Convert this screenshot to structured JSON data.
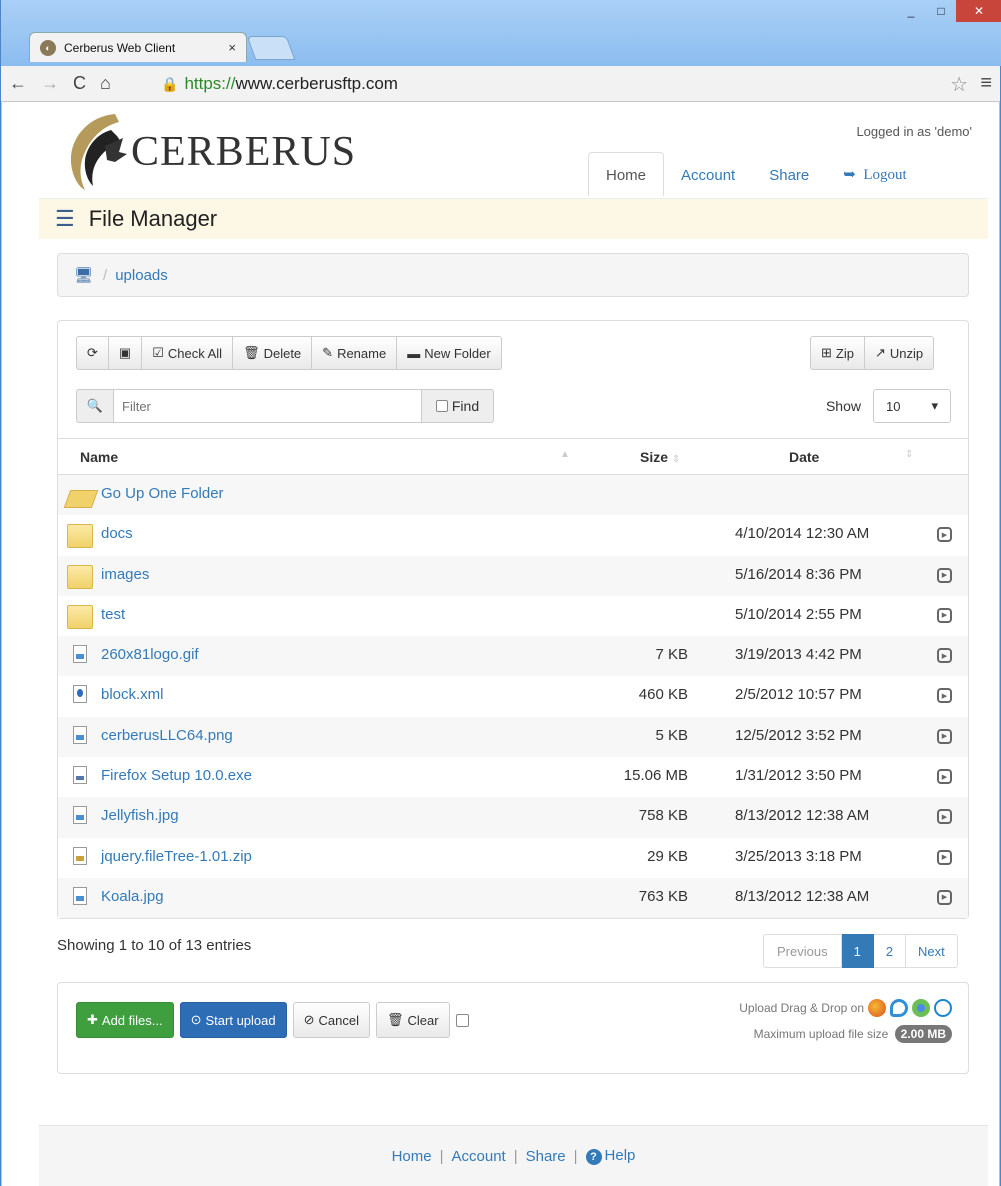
{
  "browser": {
    "tab_title": "Cerberus Web Client",
    "tab_close": "×",
    "url_scheme": "https://",
    "url_host": "www.cerberusftp.com",
    "min_glyph": "_",
    "max_glyph": "□",
    "close_glyph": "✕"
  },
  "header": {
    "brand": "CERBERUS",
    "login_status": "Logged in as 'demo'",
    "nav": {
      "home": "Home",
      "account": "Account",
      "share": "Share",
      "logout": "Logout"
    }
  },
  "file_manager": {
    "title": "File Manager",
    "breadcrumb_sep": "/",
    "breadcrumb_folder": "uploads"
  },
  "toolbar": {
    "check_all": "Check All",
    "delete": "Delete",
    "rename": "Rename",
    "new_folder": "New Folder",
    "zip": "Zip",
    "unzip": "Unzip",
    "filter_placeholder": "Filter",
    "find": "Find",
    "show_label": "Show",
    "show_value": "10"
  },
  "table": {
    "headers": {
      "name": "Name",
      "size": "Size",
      "date": "Date"
    },
    "up_folder": "Go Up One Folder",
    "rows": [
      {
        "name": "docs",
        "size": "",
        "date": "4/10/2014 12:30 AM",
        "icon": "folder-icon"
      },
      {
        "name": "images",
        "size": "",
        "date": "5/16/2014 8:36 PM",
        "icon": "folder-icon"
      },
      {
        "name": "test",
        "size": "",
        "date": "5/10/2014 2:55 PM",
        "icon": "folder-icon"
      },
      {
        "name": "260x81logo.gif",
        "size": "7 KB",
        "date": "3/19/2013 4:42 PM",
        "icon": "image-file-icon"
      },
      {
        "name": "block.xml",
        "size": "460 KB",
        "date": "2/5/2012 10:57 PM",
        "icon": "xml-file-icon"
      },
      {
        "name": "cerberusLLC64.png",
        "size": "5 KB",
        "date": "12/5/2012 3:52 PM",
        "icon": "image-file-icon"
      },
      {
        "name": "Firefox Setup 10.0.exe",
        "size": "15.06 MB",
        "date": "1/31/2012 3:50 PM",
        "icon": "exe-file-icon"
      },
      {
        "name": "Jellyfish.jpg",
        "size": "758 KB",
        "date": "8/13/2012 12:38 AM",
        "icon": "image-file-icon"
      },
      {
        "name": "jquery.fileTree-1.01.zip",
        "size": "29 KB",
        "date": "3/25/2013 3:18 PM",
        "icon": "zip-file-icon"
      },
      {
        "name": "Koala.jpg",
        "size": "763 KB",
        "date": "8/13/2012 12:38 AM",
        "icon": "image-file-icon"
      }
    ]
  },
  "pagination": {
    "info": "Showing 1 to 10 of 13 entries",
    "previous": "Previous",
    "page1": "1",
    "page2": "2",
    "next": "Next"
  },
  "upload": {
    "add_files": "Add files...",
    "start_upload": "Start upload",
    "cancel": "Cancel",
    "clear": "Clear",
    "drag_drop_text": "Upload Drag & Drop on",
    "max_size_label": "Maximum upload file size",
    "max_size_value": "2.00 MB"
  },
  "footer": {
    "home": "Home",
    "account": "Account",
    "share": "Share",
    "help": "Help",
    "sep": "|"
  },
  "colors": {
    "link": "#337ab7",
    "add_files_bg": "#3f9f3f",
    "start_upload_bg": "#2d6db5",
    "fm_bar_bg": "#fdf8e6"
  }
}
